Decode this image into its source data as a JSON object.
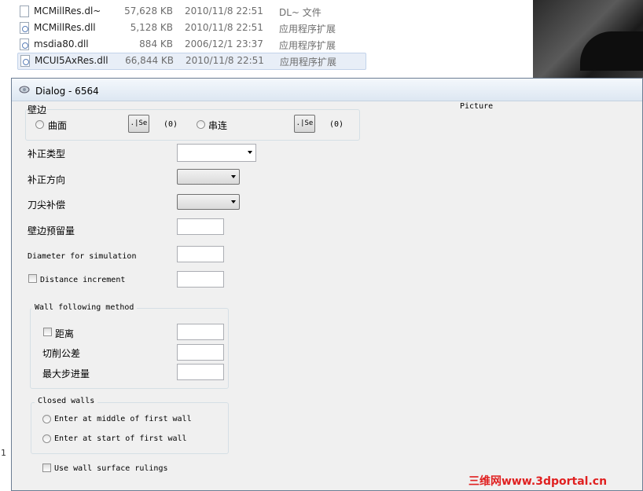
{
  "explorer": {
    "files": [
      {
        "name": "MCMillRes.dl~",
        "size": "57,628 KB",
        "date": "2010/11/8 22:51",
        "type": "DL~ 文件"
      },
      {
        "name": "MCMillRes.dll",
        "size": "5,128 KB",
        "date": "2010/11/8 22:51",
        "type": "应用程序扩展"
      },
      {
        "name": "msdia80.dll",
        "size": "884 KB",
        "date": "2006/12/1 23:37",
        "type": "应用程序扩展"
      },
      {
        "name": "MCUI5AxRes.dll",
        "size": "66,844 KB",
        "date": "2010/11/8 22:51",
        "type": "应用程序扩展"
      }
    ],
    "left_strip_text": "1"
  },
  "dialog": {
    "title": "Dialog -  6564",
    "picture_label": "Picture",
    "wall_group": {
      "title": "壁边",
      "surface_label": "曲面",
      "surface_button": ".|Se",
      "surface_count": "(0)",
      "chain_label": "串连",
      "chain_button": ".|Se",
      "chain_count": "(0)"
    },
    "comp_type_label": "补正类型",
    "comp_dir_label": "补正方向",
    "tip_comp_label": "刀尖补偿",
    "wall_stock_label": "壁边预留量",
    "diameter_label": "Diameter for simulation",
    "distance_inc_label": "Distance increment",
    "wall_following": {
      "title": "Wall following method",
      "distance_label": "距离",
      "cut_tol_label": "切削公差",
      "max_step_label": "最大步进量"
    },
    "closed_walls": {
      "title": "Closed walls",
      "opt_middle": "Enter at middle of first wall",
      "opt_start": "Enter at start of first wall"
    },
    "rulings_label": "Use wall surface rulings"
  },
  "watermark": "三维网www.3dportal.cn"
}
